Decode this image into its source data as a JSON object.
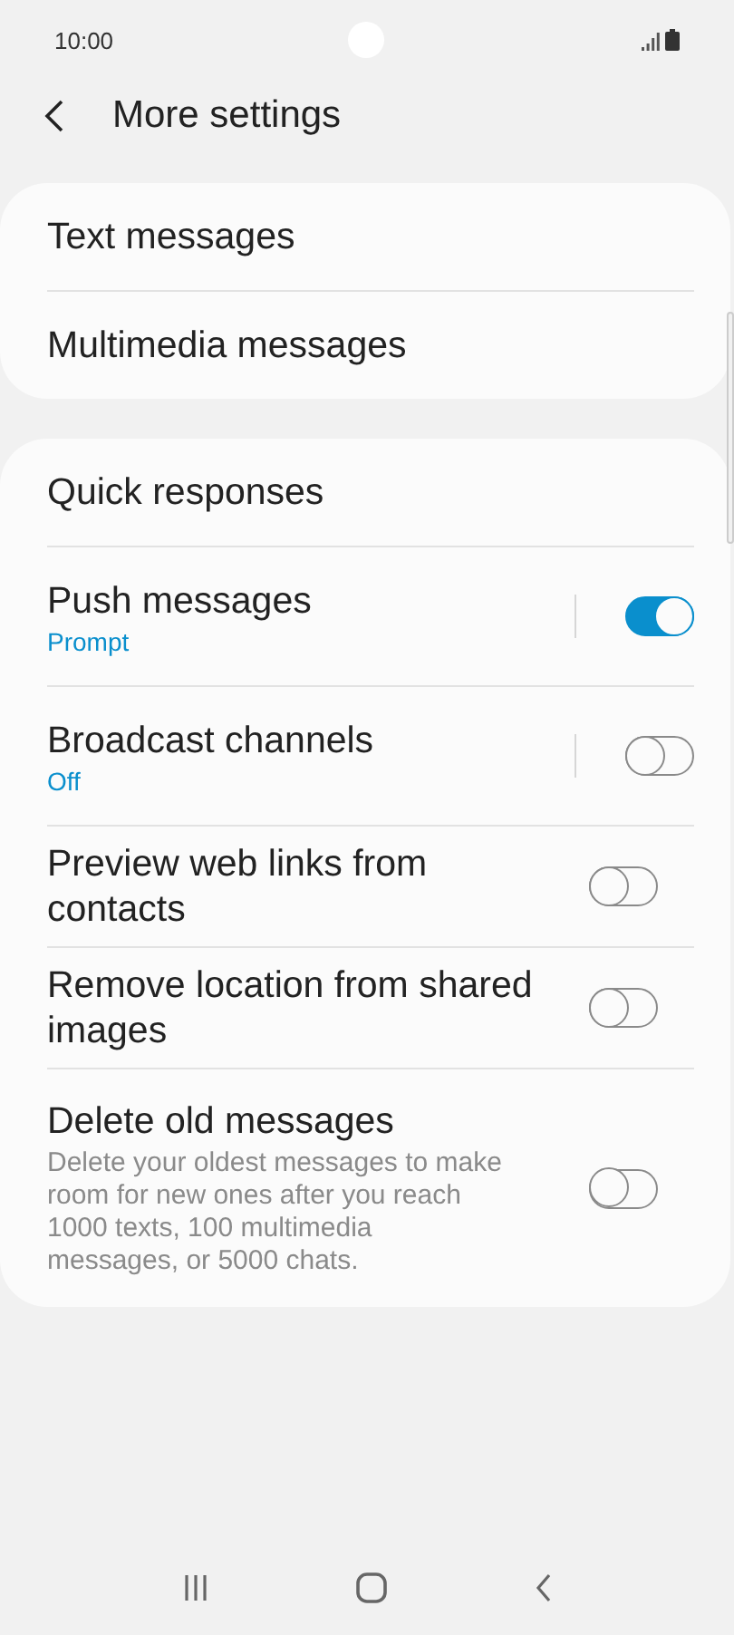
{
  "status_bar": {
    "time": "10:00"
  },
  "header": {
    "title": "More settings"
  },
  "groups": [
    {
      "items": [
        {
          "kind": "link",
          "title": "Text messages"
        },
        {
          "kind": "link",
          "title": "Multimedia messages"
        }
      ]
    },
    {
      "items": [
        {
          "kind": "link",
          "title": "Quick responses"
        },
        {
          "kind": "split-toggle",
          "title": "Push messages",
          "subtitle": "Prompt",
          "on": true
        },
        {
          "kind": "split-toggle",
          "title": "Broadcast channels",
          "subtitle": "Off",
          "on": false
        },
        {
          "kind": "toggle",
          "title": "Preview web links from contacts",
          "on": false
        },
        {
          "kind": "toggle",
          "title": "Remove location from shared images",
          "on": false
        },
        {
          "kind": "toggle",
          "title": "Delete old messages",
          "description": "Delete your oldest messages to make room for new ones after you reach 1000 texts, 100 multimedia messages, or 5000 chats.",
          "on": false
        }
      ]
    }
  ]
}
